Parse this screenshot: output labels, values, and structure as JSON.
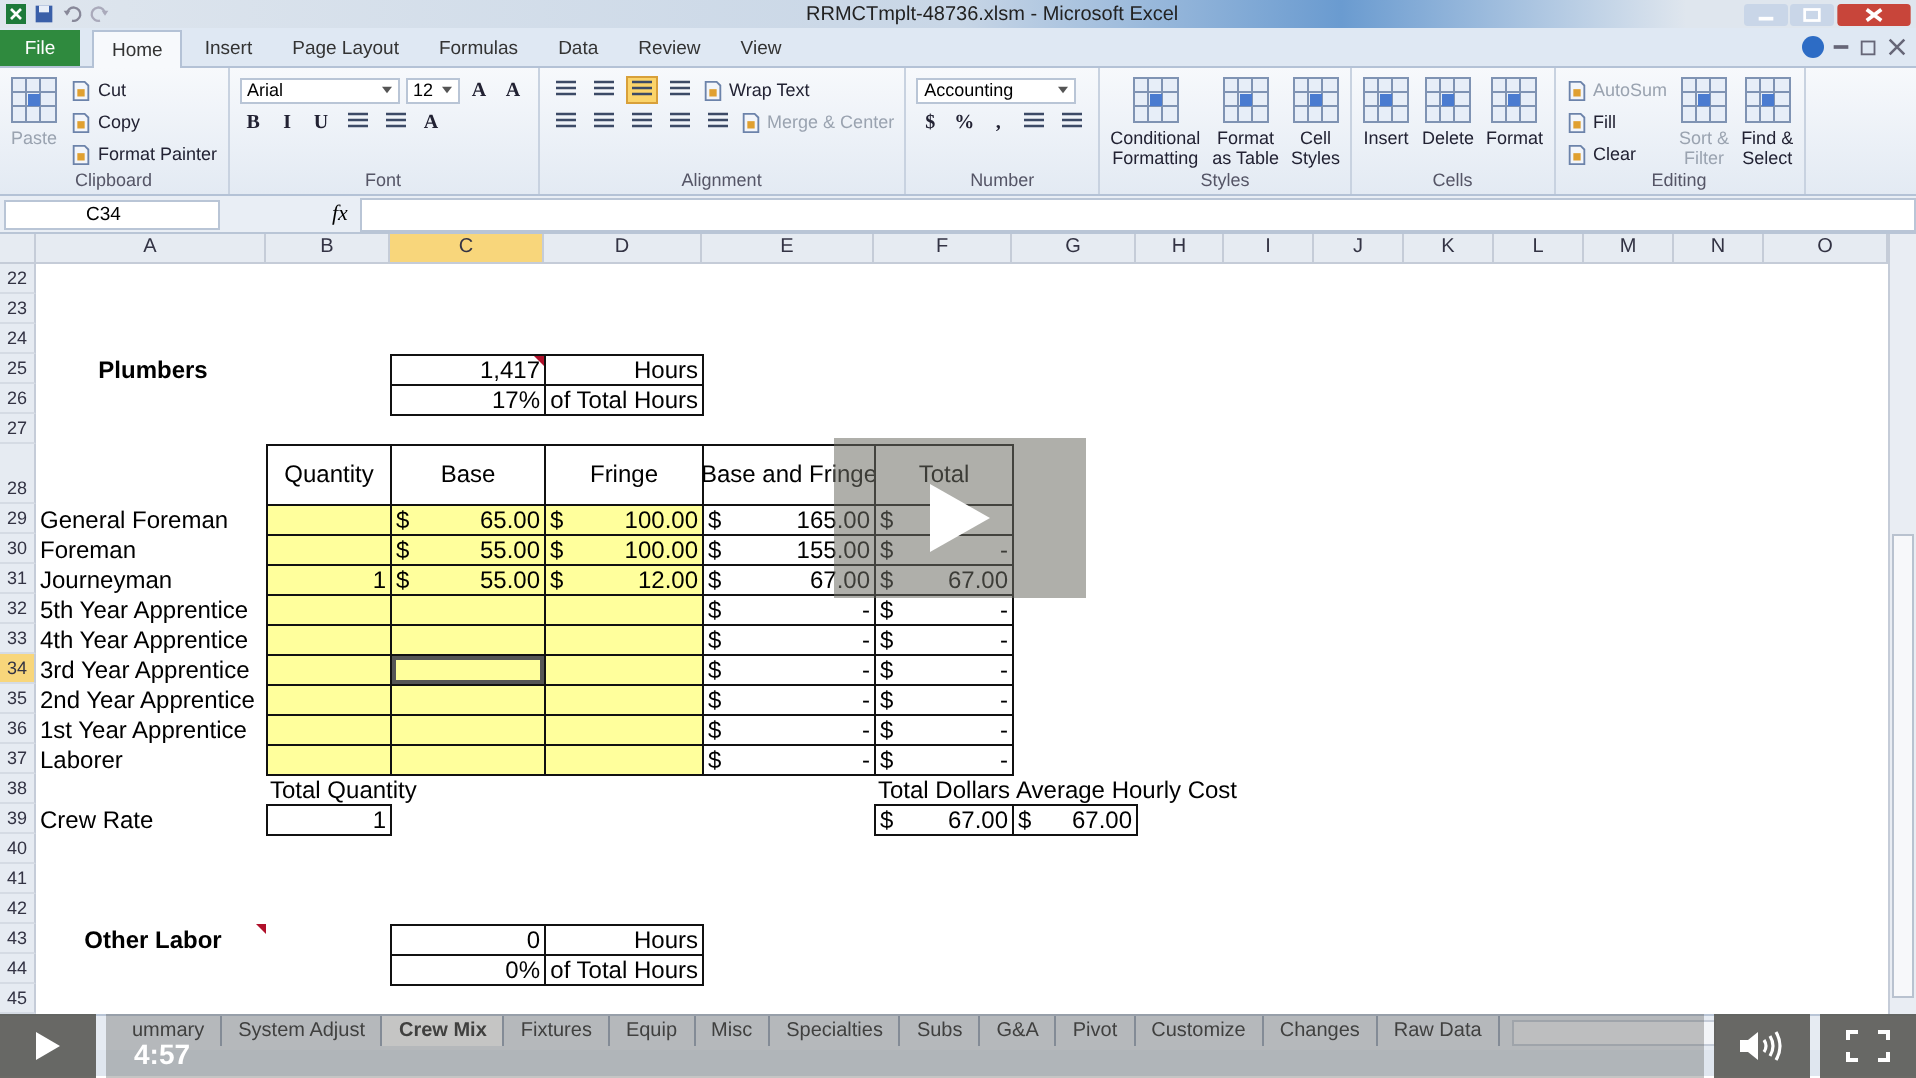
{
  "window": {
    "title": "RRMCTmplt-48736.xlsm - Microsoft Excel"
  },
  "ribbon_tabs": [
    {
      "label": "File",
      "kind": "file",
      "selected": false
    },
    {
      "label": "Home",
      "kind": "tab",
      "selected": true
    },
    {
      "label": "Insert",
      "kind": "tab",
      "selected": false
    },
    {
      "label": "Page Layout",
      "kind": "tab",
      "selected": false
    },
    {
      "label": "Formulas",
      "kind": "tab",
      "selected": false
    },
    {
      "label": "Data",
      "kind": "tab",
      "selected": false
    },
    {
      "label": "Review",
      "kind": "tab",
      "selected": false
    },
    {
      "label": "View",
      "kind": "tab",
      "selected": false
    }
  ],
  "ribbon": [
    {
      "label": "Clipboard",
      "columns": [
        {
          "kind": "large",
          "label": "Paste",
          "disabled": true
        },
        {
          "kind": "rows",
          "rows": [
            [
              {
                "kind": "small",
                "label": "Cut",
                "disabled": false
              }
            ],
            [
              {
                "kind": "small",
                "label": "Copy",
                "disabled": false
              }
            ],
            [
              {
                "kind": "small",
                "label": "Format Painter",
                "disabled": false
              }
            ]
          ]
        }
      ]
    },
    {
      "label": "Font",
      "columns": [
        {
          "kind": "rows",
          "rows": [
            [
              {
                "kind": "dropdown",
                "label": "Arial"
              },
              {
                "kind": "dropdown",
                "label": "12"
              },
              {
                "kind": "glyph",
                "label": "A"
              },
              {
                "kind": "glyph",
                "label": "A"
              }
            ],
            [
              {
                "kind": "glyph",
                "label": "B"
              },
              {
                "kind": "glyph",
                "label": "I"
              },
              {
                "kind": "glyph",
                "label": "U"
              },
              {
                "kind": "icon",
                "selected": false
              },
              {
                "kind": "icon",
                "selected": false
              },
              {
                "kind": "glyph",
                "label": "A"
              }
            ]
          ]
        }
      ]
    },
    {
      "label": "Alignment",
      "columns": [
        {
          "kind": "rows",
          "rows": [
            [
              {
                "kind": "icon",
                "selected": false
              },
              {
                "kind": "icon",
                "selected": false
              },
              {
                "kind": "icon",
                "selected": true
              },
              {
                "kind": "icon",
                "selected": false
              },
              {
                "kind": "small",
                "label": "Wrap Text",
                "disabled": false
              }
            ],
            [
              {
                "kind": "icon",
                "selected": false
              },
              {
                "kind": "icon",
                "selected": false
              },
              {
                "kind": "icon",
                "selected": false
              },
              {
                "kind": "icon",
                "selected": false
              },
              {
                "kind": "icon",
                "selected": false
              },
              {
                "kind": "small",
                "label": "Merge & Center",
                "disabled": true
              }
            ]
          ]
        }
      ]
    },
    {
      "label": "Number",
      "columns": [
        {
          "kind": "rows",
          "rows": [
            [
              {
                "kind": "dropdown",
                "label": "Accounting"
              }
            ],
            [
              {
                "kind": "glyph",
                "label": "$"
              },
              {
                "kind": "glyph",
                "label": "%"
              },
              {
                "kind": "glyph",
                "label": ","
              },
              {
                "kind": "icon",
                "selected": false
              },
              {
                "kind": "icon",
                "selected": false
              }
            ]
          ]
        }
      ]
    },
    {
      "label": "Styles",
      "columns": [
        {
          "kind": "large",
          "label": "Conditional\nFormatting",
          "disabled": false
        },
        {
          "kind": "large",
          "label": "Format\nas Table",
          "disabled": false
        },
        {
          "kind": "large",
          "label": "Cell\nStyles",
          "disabled": false
        }
      ]
    },
    {
      "label": "Cells",
      "columns": [
        {
          "kind": "large",
          "label": "Insert",
          "disabled": false
        },
        {
          "kind": "large",
          "label": "Delete",
          "disabled": false
        },
        {
          "kind": "large",
          "label": "Format",
          "disabled": false
        }
      ]
    },
    {
      "label": "Editing",
      "columns": [
        {
          "kind": "rows",
          "rows": [
            [
              {
                "kind": "small",
                "label": "AutoSum",
                "disabled": true
              }
            ],
            [
              {
                "kind": "small",
                "label": "Fill",
                "disabled": false
              }
            ],
            [
              {
                "kind": "small",
                "label": "Clear",
                "disabled": false
              }
            ]
          ]
        },
        {
          "kind": "large",
          "label": "Sort &\nFilter",
          "disabled": true
        },
        {
          "kind": "large",
          "label": "Find &\nSelect",
          "disabled": false
        }
      ]
    }
  ],
  "formula_bar": {
    "cell": "C34",
    "function_label": "fx"
  },
  "sheet": {
    "columns": [
      "A",
      "B",
      "C",
      "D",
      "E",
      "F",
      "G",
      "H",
      "I",
      "J",
      "K",
      "L",
      "M",
      "N",
      "O"
    ],
    "rows": [
      {
        "number": "22"
      },
      {
        "number": "23"
      },
      {
        "number": "24"
      },
      {
        "number": "25",
        "cells": {
          "A": {
            "kind": "heading",
            "text": "Plumbers",
            "selected": false
          },
          "C": {
            "kind": "boxed",
            "value": "1,417",
            "comment": true,
            "selected": false
          },
          "D": {
            "kind": "boxed",
            "text": "Hours",
            "selected": false
          }
        }
      },
      {
        "number": "26",
        "cells": {
          "C": {
            "kind": "boxed",
            "value": "17%",
            "selected": false
          },
          "D": {
            "kind": "boxed",
            "text": "of Total Hours",
            "selected": false
          }
        }
      },
      {
        "number": "27"
      },
      {
        "number": "28",
        "cells": {
          "B": {
            "kind": "header",
            "text": "Quantity",
            "selected": false
          },
          "C": {
            "kind": "header",
            "text": "Base",
            "selected": false
          },
          "D": {
            "kind": "header",
            "text": "Fringe",
            "selected": false
          },
          "E": {
            "kind": "header",
            "text": "Base and Fringe",
            "selected": false
          },
          "F": {
            "kind": "header",
            "text": "Total",
            "selected": false
          }
        }
      },
      {
        "number": "29",
        "cells": {
          "A": {
            "kind": "text",
            "text": "General Foreman",
            "selected": false
          },
          "B": {
            "kind": "input",
            "selected": false
          },
          "C": {
            "kind": "input",
            "symbol": "$",
            "value": "65.00",
            "selected": false
          },
          "D": {
            "kind": "input",
            "symbol": "$",
            "value": "100.00",
            "selected": false
          },
          "E": {
            "kind": "boxed",
            "symbol": "$",
            "value": "165.00",
            "selected": false
          },
          "F": {
            "kind": "boxed",
            "symbol": "$",
            "selected": false
          }
        }
      },
      {
        "number": "30",
        "cells": {
          "A": {
            "kind": "text",
            "text": "Foreman",
            "selected": false
          },
          "B": {
            "kind": "input",
            "selected": false
          },
          "C": {
            "kind": "input",
            "symbol": "$",
            "value": "55.00",
            "selected": false
          },
          "D": {
            "kind": "input",
            "symbol": "$",
            "value": "100.00",
            "selected": false
          },
          "E": {
            "kind": "boxed",
            "symbol": "$",
            "value": "155.00",
            "selected": false
          },
          "F": {
            "kind": "boxed",
            "symbol": "$",
            "value": "-",
            "selected": false
          }
        }
      },
      {
        "number": "31",
        "cells": {
          "A": {
            "kind": "text",
            "text": "Journeyman",
            "selected": false
          },
          "B": {
            "kind": "input",
            "value": "1",
            "selected": false
          },
          "C": {
            "kind": "input",
            "symbol": "$",
            "value": "55.00",
            "selected": false
          },
          "D": {
            "kind": "input",
            "symbol": "$",
            "value": "12.00",
            "selected": false
          },
          "E": {
            "kind": "boxed",
            "symbol": "$",
            "value": "67.00",
            "selected": false
          },
          "F": {
            "kind": "boxed",
            "symbol": "$",
            "value": "67.00",
            "selected": false
          }
        }
      },
      {
        "number": "32",
        "cells": {
          "A": {
            "kind": "text",
            "text": "5th Year Apprentice",
            "selected": false
          },
          "B": {
            "kind": "input",
            "selected": false
          },
          "C": {
            "kind": "input",
            "selected": false
          },
          "D": {
            "kind": "input",
            "selected": false
          },
          "E": {
            "kind": "boxed",
            "symbol": "$",
            "value": "-",
            "selected": false
          },
          "F": {
            "kind": "boxed",
            "symbol": "$",
            "value": "-",
            "selected": false
          }
        }
      },
      {
        "number": "33",
        "cells": {
          "A": {
            "kind": "text",
            "text": "4th Year Apprentice",
            "selected": false
          },
          "B": {
            "kind": "input",
            "selected": false
          },
          "C": {
            "kind": "input",
            "selected": false
          },
          "D": {
            "kind": "input",
            "selected": false
          },
          "E": {
            "kind": "boxed",
            "symbol": "$",
            "value": "-",
            "selected": false
          },
          "F": {
            "kind": "boxed",
            "symbol": "$",
            "value": "-",
            "selected": false
          }
        }
      },
      {
        "number": "34",
        "cells": {
          "A": {
            "kind": "text",
            "text": "3rd Year Apprentice",
            "selected": false
          },
          "B": {
            "kind": "input",
            "selected": false
          },
          "C": {
            "kind": "input",
            "selected": true
          },
          "D": {
            "kind": "input",
            "selected": false
          },
          "E": {
            "kind": "boxed",
            "symbol": "$",
            "value": "-",
            "selected": false
          },
          "F": {
            "kind": "boxed",
            "symbol": "$",
            "value": "-",
            "selected": false
          }
        }
      },
      {
        "number": "35",
        "cells": {
          "A": {
            "kind": "text",
            "text": "2nd Year Apprentice",
            "selected": false
          },
          "B": {
            "kind": "input",
            "selected": false
          },
          "C": {
            "kind": "input",
            "selected": false
          },
          "D": {
            "kind": "input",
            "selected": false
          },
          "E": {
            "kind": "boxed",
            "symbol": "$",
            "value": "-",
            "selected": false
          },
          "F": {
            "kind": "boxed",
            "symbol": "$",
            "value": "-",
            "selected": false
          }
        }
      },
      {
        "number": "36",
        "cells": {
          "A": {
            "kind": "text",
            "text": "1st Year Apprentice",
            "selected": false
          },
          "B": {
            "kind": "input",
            "selected": false
          },
          "C": {
            "kind": "input",
            "selected": false
          },
          "D": {
            "kind": "input",
            "selected": false
          },
          "E": {
            "kind": "boxed",
            "symbol": "$",
            "value": "-",
            "selected": false
          },
          "F": {
            "kind": "boxed",
            "symbol": "$",
            "value": "-",
            "selected": false
          }
        }
      },
      {
        "number": "37",
        "cells": {
          "A": {
            "kind": "text",
            "text": "Laborer",
            "selected": false
          },
          "B": {
            "kind": "input",
            "selected": false
          },
          "C": {
            "kind": "input",
            "selected": false
          },
          "D": {
            "kind": "input",
            "selected": false
          },
          "E": {
            "kind": "boxed",
            "symbol": "$",
            "value": "-",
            "selected": false
          },
          "F": {
            "kind": "boxed",
            "symbol": "$",
            "value": "-",
            "selected": false
          }
        }
      },
      {
        "number": "38",
        "cells": {
          "B": {
            "kind": "text",
            "text": "Total Quantity",
            "selected": false
          },
          "F": {
            "kind": "text",
            "text": "Total Dollars",
            "selected": false
          },
          "G": {
            "kind": "text",
            "text": "Average Hourly Cost",
            "selected": false
          }
        }
      },
      {
        "number": "39",
        "cells": {
          "A": {
            "kind": "text",
            "text": "Crew Rate",
            "selected": false
          },
          "B": {
            "kind": "boxed",
            "value": "1",
            "selected": false
          },
          "F": {
            "kind": "boxed",
            "symbol": "$",
            "value": "67.00",
            "selected": false
          },
          "G": {
            "kind": "boxed",
            "symbol": "$",
            "value": "67.00",
            "selected": false
          }
        }
      },
      {
        "number": "40"
      },
      {
        "number": "41"
      },
      {
        "number": "42"
      },
      {
        "number": "43",
        "cells": {
          "A": {
            "kind": "heading",
            "text": "Other Labor",
            "comment": true,
            "selected": false
          },
          "C": {
            "kind": "boxed",
            "value": "0",
            "selected": false
          },
          "D": {
            "kind": "boxed",
            "text": "Hours",
            "selected": false
          }
        }
      },
      {
        "number": "44",
        "cells": {
          "C": {
            "kind": "boxed",
            "value": "0%",
            "selected": false
          },
          "D": {
            "kind": "boxed",
            "text": "of Total Hours",
            "selected": false
          }
        }
      },
      {
        "number": "45"
      }
    ]
  },
  "sheet_tabs": [
    {
      "label": "ummary",
      "selected": false
    },
    {
      "label": "System Adjust",
      "selected": false
    },
    {
      "label": "Crew Mix",
      "selected": true
    },
    {
      "label": "Fixtures",
      "selected": false
    },
    {
      "label": "Equip",
      "selected": false
    },
    {
      "label": "Misc",
      "selected": false
    },
    {
      "label": "Specialties",
      "selected": false
    },
    {
      "label": "Subs",
      "selected": false
    },
    {
      "label": "G&A",
      "selected": false
    },
    {
      "label": "Pivot",
      "selected": false
    },
    {
      "label": "Customize",
      "selected": false
    },
    {
      "label": "Changes",
      "selected": false
    },
    {
      "label": "Raw Data",
      "selected": false
    }
  ],
  "video": {
    "time": "4:57"
  }
}
